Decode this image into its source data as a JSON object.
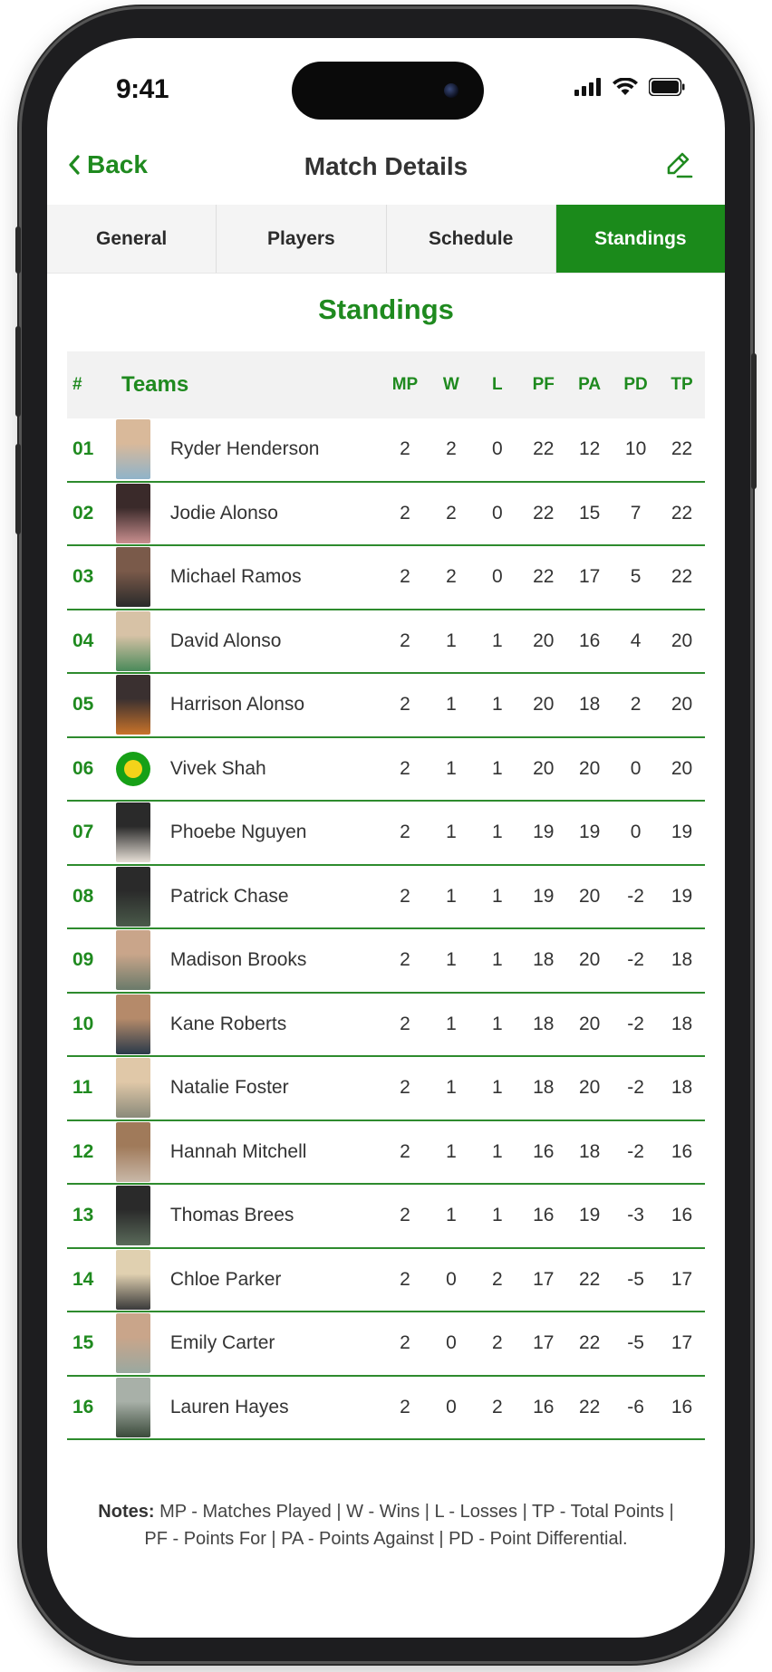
{
  "status": {
    "time": "9:41"
  },
  "nav": {
    "back_label": "Back",
    "title": "Match Details"
  },
  "tabs": [
    {
      "label": "General",
      "active": false
    },
    {
      "label": "Players",
      "active": false
    },
    {
      "label": "Schedule",
      "active": false
    },
    {
      "label": "Standings",
      "active": true
    }
  ],
  "section_title": "Standings",
  "table": {
    "headers": {
      "num": "#",
      "teams": "Teams",
      "mp": "MP",
      "w": "W",
      "l": "L",
      "pf": "PF",
      "pa": "PA",
      "pd": "PD",
      "tp": "TP"
    },
    "rows": [
      {
        "num": "01",
        "name": "Ryder Henderson",
        "mp": "2",
        "w": "2",
        "l": "0",
        "pf": "22",
        "pa": "12",
        "pd": "10",
        "tp": "22",
        "avatar": "photo"
      },
      {
        "num": "02",
        "name": "Jodie Alonso",
        "mp": "2",
        "w": "2",
        "l": "0",
        "pf": "22",
        "pa": "15",
        "pd": "7",
        "tp": "22",
        "avatar": "photo"
      },
      {
        "num": "03",
        "name": "Michael Ramos",
        "mp": "2",
        "w": "2",
        "l": "0",
        "pf": "22",
        "pa": "17",
        "pd": "5",
        "tp": "22",
        "avatar": "photo"
      },
      {
        "num": "04",
        "name": "David Alonso",
        "mp": "2",
        "w": "1",
        "l": "1",
        "pf": "20",
        "pa": "16",
        "pd": "4",
        "tp": "20",
        "avatar": "photo"
      },
      {
        "num": "05",
        "name": "Harrison Alonso",
        "mp": "2",
        "w": "1",
        "l": "1",
        "pf": "20",
        "pa": "18",
        "pd": "2",
        "tp": "20",
        "avatar": "photo"
      },
      {
        "num": "06",
        "name": "Vivek Shah",
        "mp": "2",
        "w": "1",
        "l": "1",
        "pf": "20",
        "pa": "20",
        "pd": "0",
        "tp": "20",
        "avatar": "pickleball"
      },
      {
        "num": "07",
        "name": "Phoebe Nguyen",
        "mp": "2",
        "w": "1",
        "l": "1",
        "pf": "19",
        "pa": "19",
        "pd": "0",
        "tp": "19",
        "avatar": "photo"
      },
      {
        "num": "08",
        "name": "Patrick Chase",
        "mp": "2",
        "w": "1",
        "l": "1",
        "pf": "19",
        "pa": "20",
        "pd": "-2",
        "tp": "19",
        "avatar": "photo"
      },
      {
        "num": "09",
        "name": "Madison Brooks",
        "mp": "2",
        "w": "1",
        "l": "1",
        "pf": "18",
        "pa": "20",
        "pd": "-2",
        "tp": "18",
        "avatar": "photo"
      },
      {
        "num": "10",
        "name": "Kane Roberts",
        "mp": "2",
        "w": "1",
        "l": "1",
        "pf": "18",
        "pa": "20",
        "pd": "-2",
        "tp": "18",
        "avatar": "photo"
      },
      {
        "num": "11",
        "name": "Natalie Foster",
        "mp": "2",
        "w": "1",
        "l": "1",
        "pf": "18",
        "pa": "20",
        "pd": "-2",
        "tp": "18",
        "avatar": "photo"
      },
      {
        "num": "12",
        "name": "Hannah Mitchell",
        "mp": "2",
        "w": "1",
        "l": "1",
        "pf": "16",
        "pa": "18",
        "pd": "-2",
        "tp": "16",
        "avatar": "photo"
      },
      {
        "num": "13",
        "name": "Thomas Brees",
        "mp": "2",
        "w": "1",
        "l": "1",
        "pf": "16",
        "pa": "19",
        "pd": "-3",
        "tp": "16",
        "avatar": "photo"
      },
      {
        "num": "14",
        "name": "Chloe Parker",
        "mp": "2",
        "w": "0",
        "l": "2",
        "pf": "17",
        "pa": "22",
        "pd": "-5",
        "tp": "17",
        "avatar": "photo"
      },
      {
        "num": "15",
        "name": "Emily Carter",
        "mp": "2",
        "w": "0",
        "l": "2",
        "pf": "17",
        "pa": "22",
        "pd": "-5",
        "tp": "17",
        "avatar": "photo"
      },
      {
        "num": "16",
        "name": "Lauren Hayes",
        "mp": "2",
        "w": "0",
        "l": "2",
        "pf": "16",
        "pa": "22",
        "pd": "-6",
        "tp": "16",
        "avatar": "photo"
      }
    ]
  },
  "notes": {
    "label": "Notes:",
    "line1": "MP - Matches Played | W - Wins | L - Losses | TP - Total Points |",
    "line2": "PF - Points For | PA - Points Against | PD - Point Differential."
  },
  "colors": {
    "accent": "#1b8a1b",
    "row_divider": "#2e8b2e",
    "header_bg": "#f2f2f2"
  },
  "icons": {
    "back": "chevron-left-icon",
    "edit": "pencil-icon",
    "signal": "signal-icon",
    "wifi": "wifi-icon",
    "battery": "battery-icon"
  }
}
